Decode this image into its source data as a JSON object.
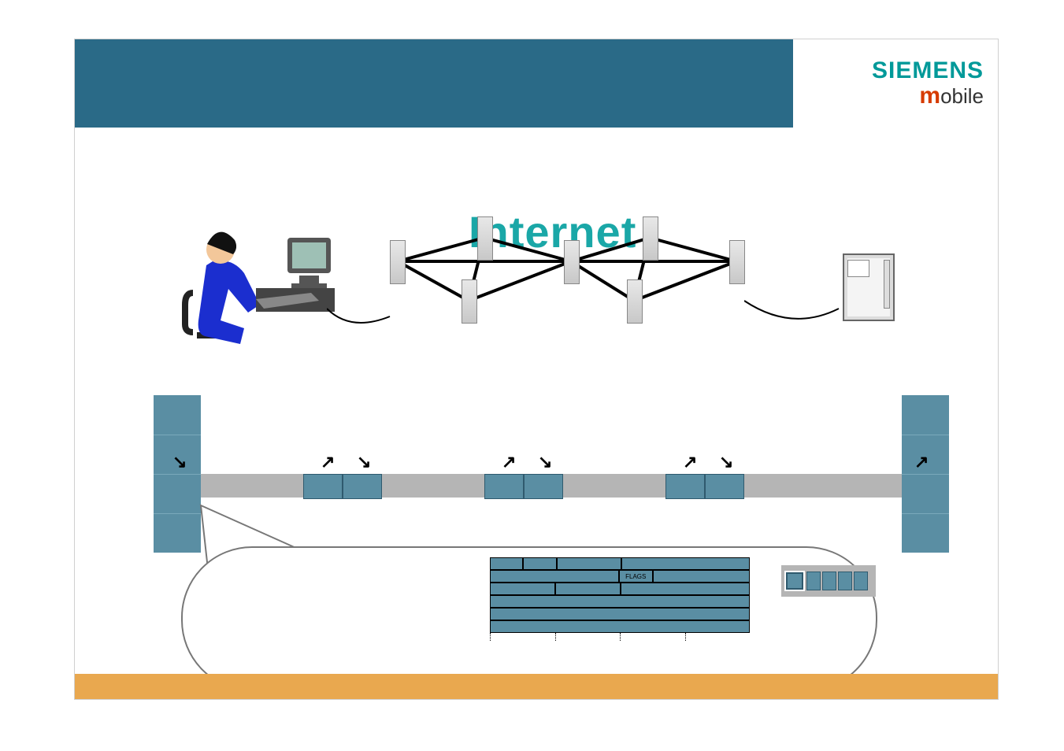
{
  "logo": {
    "brand": "SIEMENS",
    "sub_prefix": "m",
    "sub_rest": "obile"
  },
  "diagram": {
    "internet_label": "Internet",
    "ip_header": {
      "rows": [
        [
          "",
          "",
          "",
          ""
        ],
        [
          "",
          "",
          "FLAGS",
          ""
        ],
        [
          "",
          "",
          "",
          ""
        ],
        [
          ""
        ],
        [
          ""
        ],
        [
          ""
        ]
      ]
    }
  }
}
